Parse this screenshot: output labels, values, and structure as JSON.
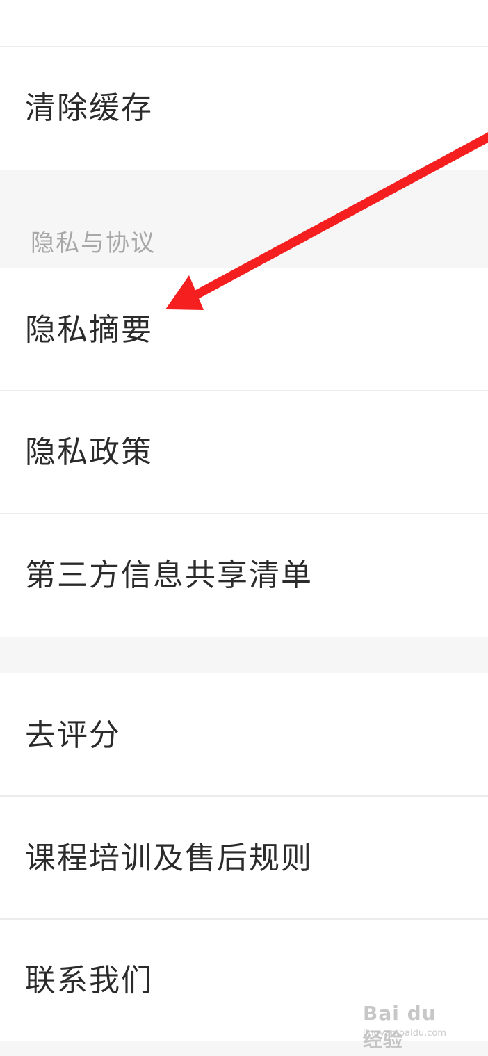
{
  "menu": {
    "top_cut_item": "",
    "clear_cache": "清除缓存",
    "section_privacy_header": "隐私与协议",
    "privacy_summary": "隐私摘要",
    "privacy_policy": "隐私政策",
    "third_party_list": "第三方信息共享清单",
    "rate": "去评分",
    "course_rules": "课程培训及售后规则",
    "contact_us": "联系我们"
  },
  "annotation": {
    "arrow_color": "#f51f1f",
    "arrow_target": "隐私摘要"
  },
  "watermark": {
    "brand": "Bai du 经验",
    "url": "jingyan.baidu.com"
  },
  "colors": {
    "row_bg": "#ffffff",
    "section_bg": "#f6f6f6",
    "divider": "#ececec",
    "text": "#2b2b2b",
    "section_text": "#a8a8a8"
  }
}
